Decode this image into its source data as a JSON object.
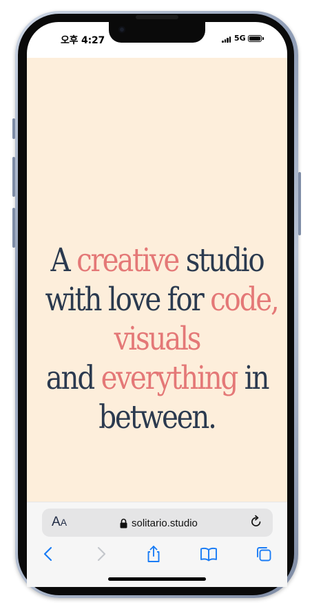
{
  "status_bar": {
    "time": "오후 4:27",
    "network": "5G"
  },
  "hero": {
    "line1": {
      "a": "A ",
      "accent": "creative",
      "b": " studio"
    },
    "line2": {
      "a": "with love for ",
      "accent": "code,"
    },
    "line3": {
      "accent": "visuals"
    },
    "line4": {
      "a": "and ",
      "accent": "everything",
      "b": " in"
    },
    "line5": {
      "a": "between."
    },
    "text_color": "#2b3a4f",
    "accent_color": "#e47877",
    "background_color": "#fdeedb"
  },
  "browser": {
    "text_size_button": {
      "big": "A",
      "small": "A"
    },
    "url": "solitario.studio",
    "icons": {
      "text_size": "text-size-icon",
      "lock": "lock-icon",
      "reload": "reload-icon",
      "back": "back-icon",
      "forward": "forward-icon",
      "share": "share-icon",
      "bookmarks": "bookmarks-icon",
      "tabs": "tabs-icon"
    },
    "accent_color": "#1a7cf5"
  }
}
